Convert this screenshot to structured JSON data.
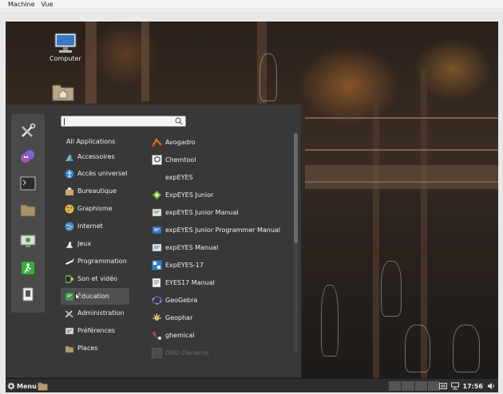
{
  "vm_menu": {
    "items": [
      "Machine",
      "Vue"
    ]
  },
  "desktop": {
    "icons": [
      {
        "label": "Computer",
        "icon": "computer-icon"
      },
      {
        "label": "",
        "icon": "home-folder-icon"
      }
    ]
  },
  "menu": {
    "search": {
      "placeholder": ""
    },
    "favorites": [
      "tools-icon",
      "chat-icon",
      "terminal-icon",
      "folder-icon",
      "screen-icon",
      "logout-icon",
      "tablet-icon"
    ],
    "categories": [
      {
        "label": "All Applications",
        "icon": ""
      },
      {
        "label": "Accessoires",
        "icon": "accessories-icon"
      },
      {
        "label": "Accès universel",
        "icon": "accessibility-icon"
      },
      {
        "label": "Bureautique",
        "icon": "office-icon"
      },
      {
        "label": "Graphisme",
        "icon": "graphics-icon"
      },
      {
        "label": "Internet",
        "icon": "internet-icon"
      },
      {
        "label": "Jeux",
        "icon": "games-icon"
      },
      {
        "label": "Programmation",
        "icon": "programming-icon"
      },
      {
        "label": "Son et vidéo",
        "icon": "multimedia-icon"
      },
      {
        "label": "Éducation",
        "icon": "education-icon"
      },
      {
        "label": "Administration",
        "icon": "administration-icon"
      },
      {
        "label": "Préférences",
        "icon": "preferences-icon"
      },
      {
        "label": "Places",
        "icon": "places-icon"
      }
    ],
    "selected_category": "Éducation",
    "apps": [
      {
        "label": "Avogadro",
        "icon": "avogadro-icon"
      },
      {
        "label": "Chemtool",
        "icon": "chemtool-icon"
      },
      {
        "label": "expEYES",
        "icon": ""
      },
      {
        "label": "ExpEYES Junior",
        "icon": "expeyes-icon"
      },
      {
        "label": "expEYES Junior Manual",
        "icon": "manual-icon"
      },
      {
        "label": "expEYES Junior Programmer Manual",
        "icon": "manual-icon"
      },
      {
        "label": "expEYES Manual",
        "icon": "manual-icon"
      },
      {
        "label": "ExpEYES-17",
        "icon": "expeyes17-icon"
      },
      {
        "label": "EYES17 Manual",
        "icon": "manual-icon"
      },
      {
        "label": "GeoGebra",
        "icon": "geogebra-icon"
      },
      {
        "label": "Geophar",
        "icon": "geophar-icon"
      },
      {
        "label": "ghemical",
        "icon": "ghemical-icon"
      },
      {
        "label": "GNU Denemo",
        "icon": "denemo-icon"
      }
    ],
    "scroll_fraction": 0.5
  },
  "panel": {
    "menu_label": "Menu",
    "clock": "17:56"
  },
  "colors": {
    "menu_bg": "#383838",
    "selection": "#505050",
    "panel_bg": "#2e2e2e"
  }
}
